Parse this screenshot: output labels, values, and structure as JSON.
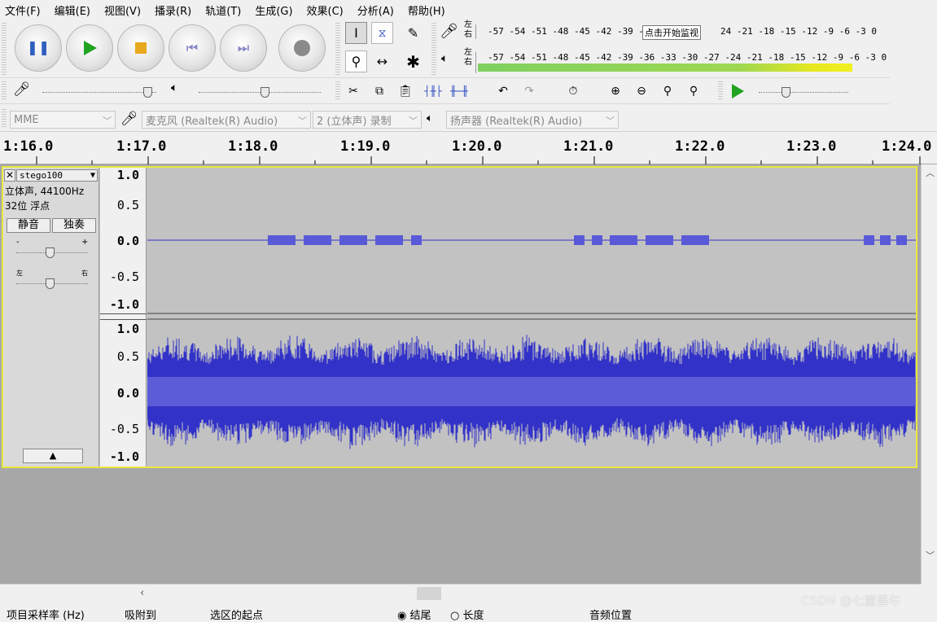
{
  "menu": [
    "文件(F)",
    "编辑(E)",
    "视图(V)",
    "播录(R)",
    "轨道(T)",
    "生成(G)",
    "效果(C)",
    "分析(A)",
    "帮助(H)"
  ],
  "meters": {
    "rec_channel_top": "左",
    "rec_channel_bottom": "右",
    "play_channel_top": "左",
    "play_channel_bottom": "右",
    "rec_scale": "-57 -54 -51 -48 -45 -42 -39 -",
    "rec_scale_tail": "24 -21 -18 -15 -12  -9  -6  -3  0",
    "rec_prompt": "点击开始监视",
    "play_scale": "-57 -54 -51 -48 -45 -42 -39 -36 -33 -30 -27 -24 -21 -18 -15 -12  -9  -6  -3  0",
    "play_level": 0.92
  },
  "devices": {
    "host": "MME",
    "input": "麦克风 (Realtek(R) Audio)",
    "channels": "2 (立体声) 录制",
    "output": "扬声器 (Realtek(R) Audio)"
  },
  "ruler": {
    "labels": [
      "1:16.0",
      "1:17.0",
      "1:18.0",
      "1:19.0",
      "1:20.0",
      "1:21.0",
      "1:22.0",
      "1:23.0",
      "1:24.0"
    ]
  },
  "track": {
    "name": "stego100",
    "format": "立体声, 44100Hz",
    "bit_depth": "32位 浮点",
    "mute_label": "静音",
    "solo_label": "独奏",
    "gain_minus": "-",
    "gain_plus": "+",
    "pan_left": "左",
    "pan_right": "右"
  },
  "amp_labels_top": [
    "1.0",
    "0.5",
    "0.0",
    "-0.5",
    "-1.0"
  ],
  "amp_labels_bottom": [
    "1.0",
    "0.5",
    "0.0",
    "-0.5",
    "-1.0"
  ],
  "status": {
    "rate_label": "项目采样率 (Hz)",
    "snap_label": "吸附到",
    "selection_label": "选区的起点",
    "end_option": "结尾",
    "length_option": "长度",
    "audio_position": "音频位置"
  },
  "watermark": "CSDN @七董墨年",
  "colors": {
    "wave": "#3232c8",
    "wave_light": "#6464dc",
    "track_bg": "#c2c2c2",
    "selection_frame": "#e8e840",
    "meter_green": "#7fd060",
    "meter_yellow": "#f0f020"
  }
}
